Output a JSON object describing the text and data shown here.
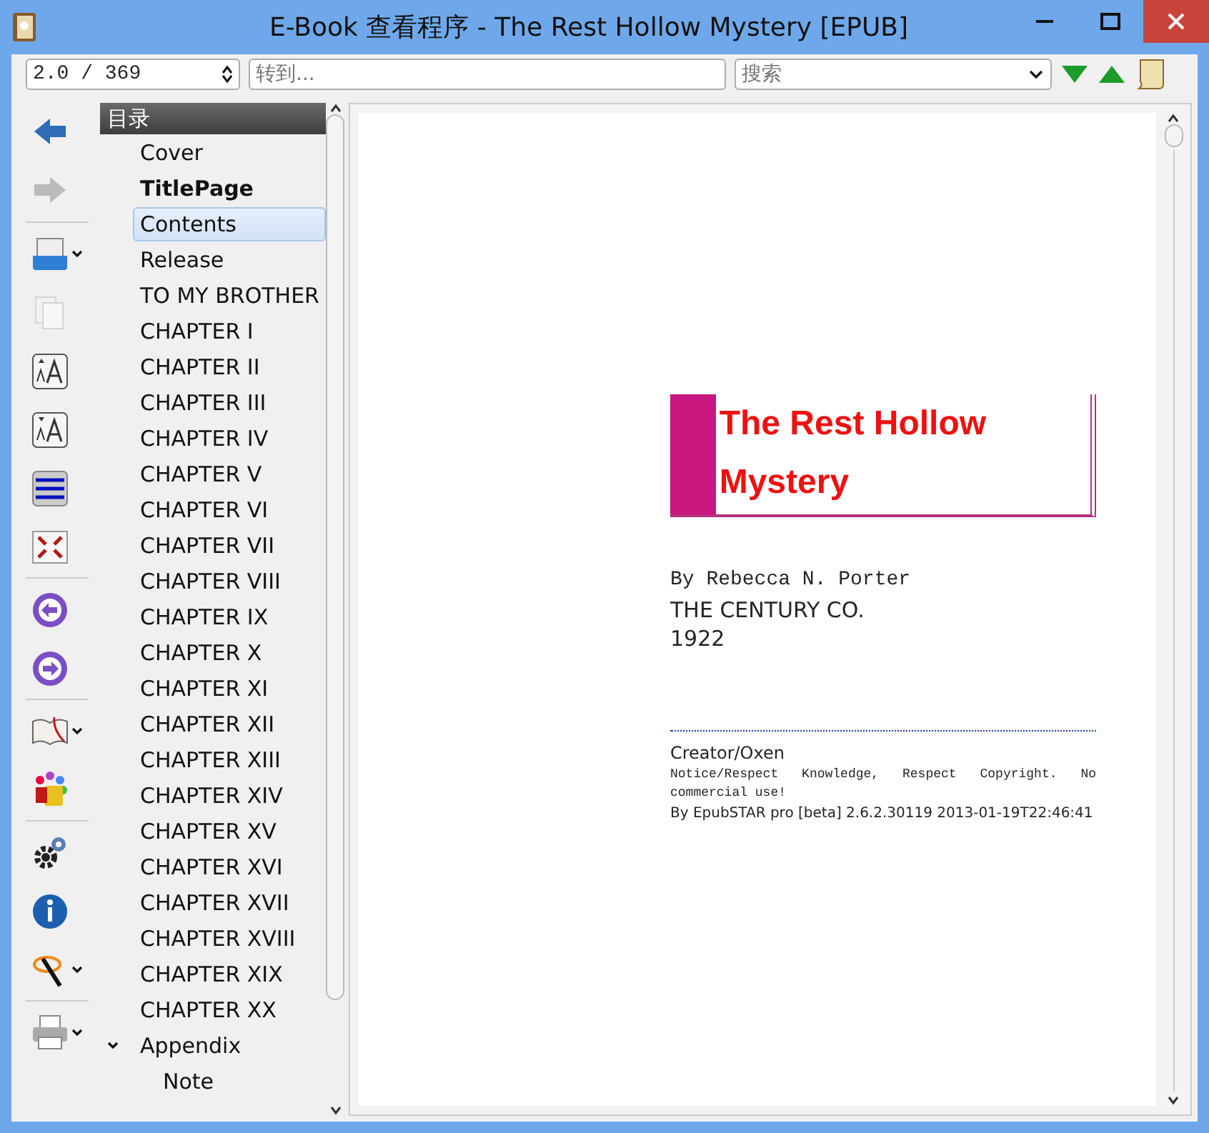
{
  "window": {
    "title": "E-Book 查看程序 - The Rest Hollow Mystery [EPUB]"
  },
  "toolbar": {
    "page_spinner": "2.0 / 369",
    "goto": {
      "placeholder": "转到..."
    },
    "search": {
      "placeholder": "搜索"
    }
  },
  "side_tools": [
    {
      "kind": "back",
      "disabled": false,
      "dropdown": false
    },
    {
      "kind": "forward",
      "disabled": true,
      "dropdown": false
    },
    {
      "kind": "separator"
    },
    {
      "kind": "open",
      "disabled": false,
      "dropdown": true
    },
    {
      "kind": "pages",
      "disabled": true,
      "dropdown": false
    },
    {
      "kind": "font-up",
      "disabled": false,
      "dropdown": false
    },
    {
      "kind": "font-down",
      "disabled": false,
      "dropdown": false
    },
    {
      "kind": "lines",
      "disabled": false,
      "dropdown": false
    },
    {
      "kind": "fullscreen",
      "disabled": false,
      "dropdown": false
    },
    {
      "kind": "separator"
    },
    {
      "kind": "prev",
      "disabled": false,
      "dropdown": false
    },
    {
      "kind": "next",
      "disabled": false,
      "dropdown": false
    },
    {
      "kind": "separator"
    },
    {
      "kind": "book",
      "disabled": false,
      "dropdown": true
    },
    {
      "kind": "palette",
      "disabled": false,
      "dropdown": false
    },
    {
      "kind": "separator"
    },
    {
      "kind": "gear",
      "disabled": false,
      "dropdown": false
    },
    {
      "kind": "info",
      "disabled": false,
      "dropdown": false
    },
    {
      "kind": "wand",
      "disabled": false,
      "dropdown": true
    },
    {
      "kind": "separator"
    },
    {
      "kind": "printer",
      "disabled": false,
      "dropdown": true
    }
  ],
  "toc": {
    "title": "目录",
    "items": [
      {
        "label": "Cover",
        "bold": false,
        "selected": false
      },
      {
        "label": "TitlePage",
        "bold": true,
        "selected": false
      },
      {
        "label": "Contents",
        "bold": false,
        "selected": true
      },
      {
        "label": "Release",
        "bold": false,
        "selected": false
      },
      {
        "label": "TO MY BROTHER",
        "bold": false,
        "selected": false
      },
      {
        "label": "CHAPTER I",
        "bold": false,
        "selected": false
      },
      {
        "label": "CHAPTER II",
        "bold": false,
        "selected": false
      },
      {
        "label": "CHAPTER III",
        "bold": false,
        "selected": false
      },
      {
        "label": "CHAPTER IV",
        "bold": false,
        "selected": false
      },
      {
        "label": "CHAPTER V",
        "bold": false,
        "selected": false
      },
      {
        "label": "CHAPTER VI",
        "bold": false,
        "selected": false
      },
      {
        "label": "CHAPTER VII",
        "bold": false,
        "selected": false
      },
      {
        "label": "CHAPTER VIII",
        "bold": false,
        "selected": false
      },
      {
        "label": "CHAPTER IX",
        "bold": false,
        "selected": false
      },
      {
        "label": "CHAPTER X",
        "bold": false,
        "selected": false
      },
      {
        "label": "CHAPTER XI",
        "bold": false,
        "selected": false
      },
      {
        "label": "CHAPTER XII",
        "bold": false,
        "selected": false
      },
      {
        "label": "CHAPTER XIII",
        "bold": false,
        "selected": false
      },
      {
        "label": "CHAPTER XIV",
        "bold": false,
        "selected": false
      },
      {
        "label": "CHAPTER XV",
        "bold": false,
        "selected": false
      },
      {
        "label": "CHAPTER XVI",
        "bold": false,
        "selected": false
      },
      {
        "label": "CHAPTER XVII",
        "bold": false,
        "selected": false
      },
      {
        "label": "CHAPTER XVIII",
        "bold": false,
        "selected": false
      },
      {
        "label": "CHAPTER XIX",
        "bold": false,
        "selected": false
      },
      {
        "label": "CHAPTER XX",
        "bold": false,
        "selected": false
      },
      {
        "label": "Appendix",
        "bold": false,
        "selected": false,
        "expanded": true,
        "children": [
          {
            "label": "Note",
            "bold": false,
            "selected": false
          }
        ]
      }
    ]
  },
  "page": {
    "book_title": "The Rest Hollow Mystery",
    "author": "By Rebecca N. Porter",
    "publisher": "THE CENTURY CO.",
    "year": "1922",
    "creator": "Creator/Oxen",
    "notice": "Notice/Respect Knowledge, Respect Copyright. No commercial use!",
    "generator": "By EpubSTAR pro [beta] 2.6.2.30119 2013-01-19T22:46:41"
  }
}
